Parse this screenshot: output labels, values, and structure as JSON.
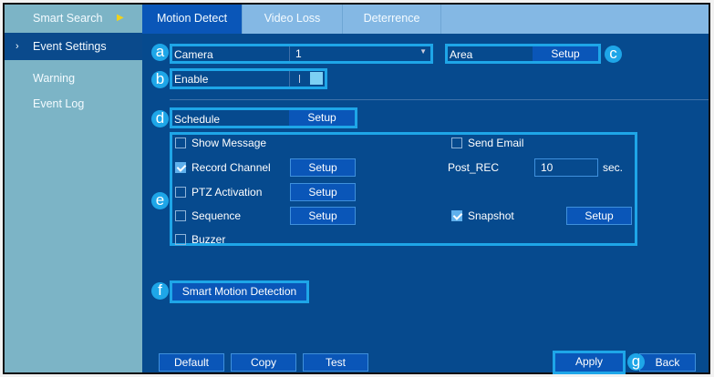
{
  "sidebar": {
    "items": [
      {
        "label": "Smart Search"
      },
      {
        "label": "Event Settings",
        "selected": true
      },
      {
        "label": "Warning"
      },
      {
        "label": "Event Log"
      }
    ]
  },
  "tabs": [
    {
      "label": "Motion Detect",
      "selected": true
    },
    {
      "label": "Video Loss"
    },
    {
      "label": "Deterrence"
    }
  ],
  "badges": {
    "a": "a",
    "b": "b",
    "c": "c",
    "d": "d",
    "e": "e",
    "f": "f",
    "g": "g"
  },
  "camera": {
    "label": "Camera",
    "value": "1"
  },
  "enable": {
    "label": "Enable",
    "on": true
  },
  "area": {
    "label": "Area",
    "button": "Setup"
  },
  "schedule": {
    "label": "Schedule",
    "button": "Setup"
  },
  "options": {
    "show_message": {
      "label": "Show Message",
      "checked": false
    },
    "send_email": {
      "label": "Send Email",
      "checked": false
    },
    "record_channel": {
      "label": "Record Channel",
      "checked": true,
      "button": "Setup"
    },
    "post_rec": {
      "label": "Post_REC",
      "value": "10",
      "unit": "sec."
    },
    "ptz": {
      "label": "PTZ Activation",
      "checked": false,
      "button": "Setup"
    },
    "sequence": {
      "label": "Sequence",
      "checked": false,
      "button": "Setup"
    },
    "snapshot": {
      "label": "Snapshot",
      "checked": true,
      "button": "Setup"
    },
    "buzzer": {
      "label": "Buzzer",
      "checked": false
    }
  },
  "smart_motion": "Smart Motion Detection",
  "footer": {
    "default": "Default",
    "copy": "Copy",
    "test": "Test",
    "apply": "Apply",
    "back": "Back"
  }
}
